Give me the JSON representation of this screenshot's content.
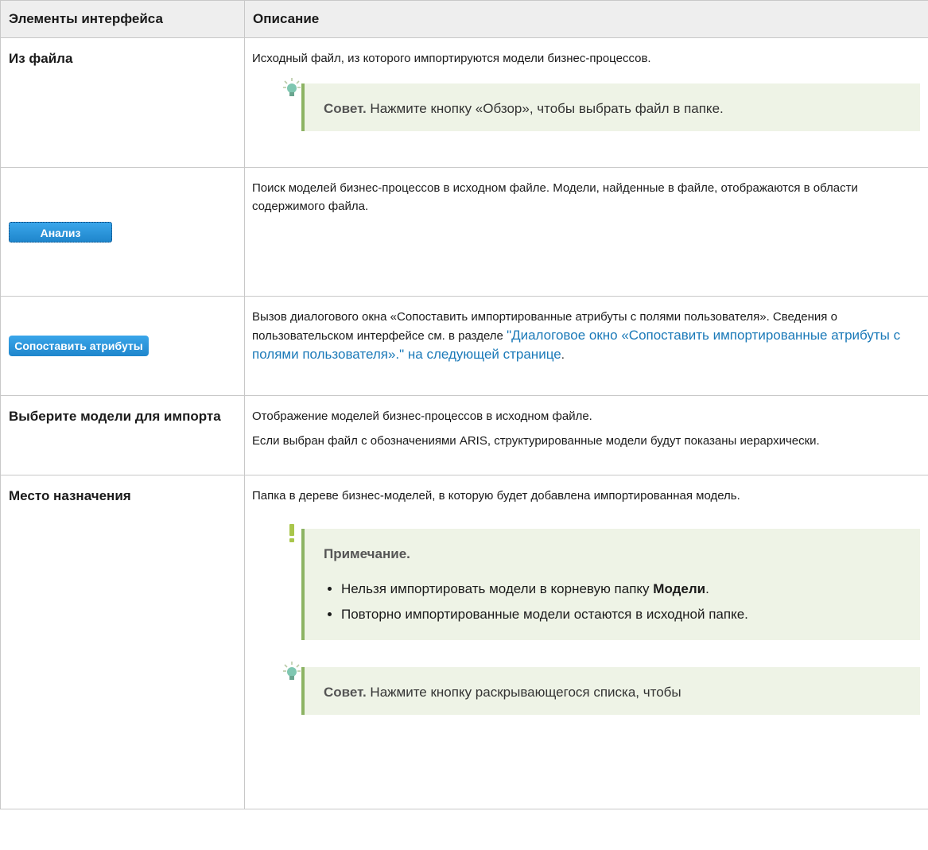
{
  "header": {
    "col1": "Элементы интерфейса",
    "col2": "Описание"
  },
  "rows": {
    "from_file": {
      "label": "Из файла",
      "desc": "Исходный файл, из которого импортируются модели бизнес-процессов.",
      "tip_label": "Совет.",
      "tip_text": " Нажмите кнопку «Обзор», чтобы выбрать файл в папке."
    },
    "analyze": {
      "button_label": "Анализ",
      "desc": "Поиск моделей бизнес-процессов в исходном файле. Модели, найденные в файле, отображаются в области содержимого файла."
    },
    "map_attrs": {
      "button_label": "Сопоставить атрибуты",
      "desc": "Вызов диалогового окна «Сопоставить импортированные атрибуты с полями пользователя». Сведения о пользовательском интерфейсе см. в разделе ",
      "link": "\"Диалоговое окно «Сопоставить импортированные атрибуты с полями пользователя».\" на следующей странице",
      "after_link": "."
    },
    "select_models": {
      "label": "Выберите модели для импорта",
      "desc1": "Отображение моделей бизнес-процессов в исходном файле.",
      "desc2": "Если выбран файл с обозначениями ARIS, структурированные модели будут показаны иерархически."
    },
    "destination": {
      "label": "Место назначения",
      "desc": "Папка в дереве бизнес-моделей, в которую будет добавлена импортированная модель.",
      "note_label": "Примечание.",
      "bullet1_text": "Нельзя импортировать модели в корневую папку ",
      "bullet1_bold": "Модели",
      "bullet1_end": ".",
      "bullet2": "Повторно импортированные модели остаются в исходной папке.",
      "tip_label": "Совет.",
      "tip_text": " Нажмите кнопку раскрывающегося списка, чтобы"
    }
  },
  "icons": {
    "tip": "lightbulb-icon",
    "note": "exclamation-icon"
  },
  "colors": {
    "accent_green": "#8cb363",
    "box_bg": "#eef3e6",
    "link": "#1a79b8",
    "button": "#2b95dd"
  }
}
